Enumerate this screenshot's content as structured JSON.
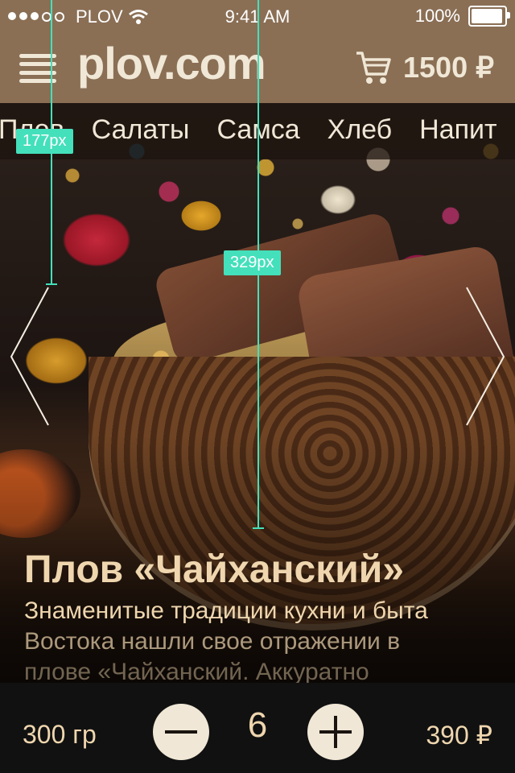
{
  "status_bar": {
    "carrier": "PLOV",
    "time": "9:41 AM",
    "battery": "100%"
  },
  "header": {
    "logo": "plov.com",
    "cart_total": "1500 ₽"
  },
  "categories": {
    "items": [
      "Плов",
      "Салаты",
      "Самса",
      "Хлеб",
      "Напит"
    ]
  },
  "measurements": {
    "left_label": "177px",
    "center_label": "329px"
  },
  "product": {
    "title": "Плов «Чайханский»",
    "description_line1": "Знаменитые традиции кухни и быта",
    "description_line2": "Востока нашли свое отражении в",
    "description_line3": "плове «Чайханский. Аккуратно"
  },
  "order": {
    "weight": "300 гр",
    "quantity": "6",
    "price": "390 ₽"
  },
  "colors": {
    "header_bg": "#8a6f55",
    "text_cream": "#efd6ae",
    "guide": "#43e0bb"
  }
}
